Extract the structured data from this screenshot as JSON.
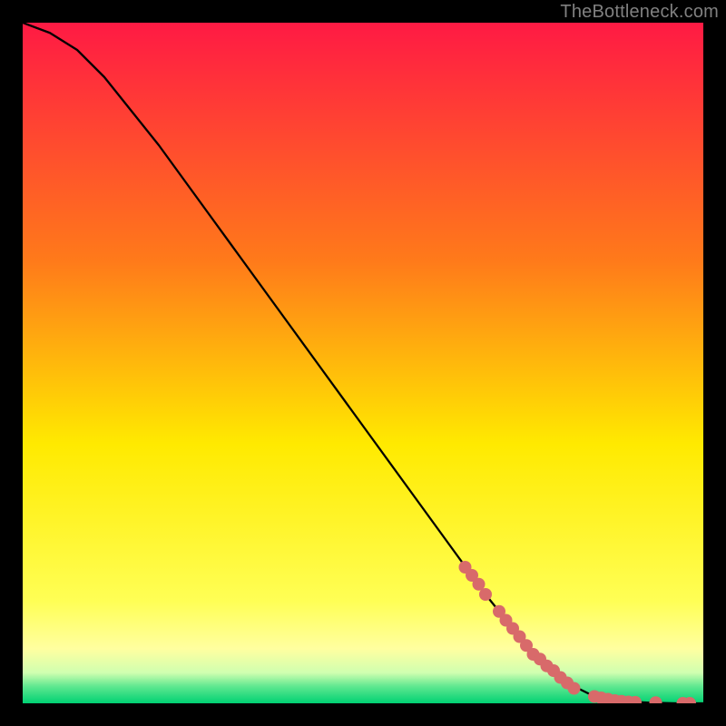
{
  "attribution": "TheBottleneck.com",
  "chart_data": {
    "type": "line",
    "title": "",
    "xlabel": "",
    "ylabel": "",
    "xlim": [
      0,
      100
    ],
    "ylim": [
      0,
      100
    ],
    "grid": false,
    "legend": false,
    "background_gradient": {
      "top": "#ff1a44",
      "mid": "#ffea00",
      "bottom_band_start": "#ffff99",
      "bottom_band_end": "#00d173"
    },
    "series": [
      {
        "name": "curve",
        "color": "#000000",
        "x": [
          0,
          4,
          8,
          12,
          16,
          20,
          24,
          28,
          32,
          36,
          40,
          44,
          48,
          52,
          56,
          60,
          64,
          68,
          72,
          76,
          80,
          84,
          88,
          92,
          96,
          100
        ],
        "values": [
          100,
          98.5,
          96.0,
          92.0,
          87.0,
          82.0,
          76.5,
          71.0,
          65.5,
          60.0,
          54.5,
          49.0,
          43.5,
          38.0,
          32.5,
          27.0,
          21.5,
          16.0,
          11.0,
          6.5,
          3.0,
          1.0,
          0.3,
          0.1,
          0.0,
          0.0
        ]
      },
      {
        "name": "markers",
        "color": "#d86a6a",
        "type": "scatter",
        "x": [
          65,
          66,
          67,
          68,
          70,
          71,
          72,
          73,
          74,
          75,
          76,
          77,
          78,
          79,
          80,
          81,
          84,
          85,
          86,
          87,
          88,
          89,
          90,
          93,
          97,
          98
        ],
        "values": [
          20.0,
          18.8,
          17.5,
          16.0,
          13.5,
          12.2,
          11.0,
          9.8,
          8.5,
          7.2,
          6.5,
          5.5,
          4.8,
          3.8,
          3.0,
          2.2,
          1.0,
          0.8,
          0.6,
          0.4,
          0.3,
          0.2,
          0.15,
          0.1,
          0.0,
          0.0
        ]
      }
    ]
  }
}
